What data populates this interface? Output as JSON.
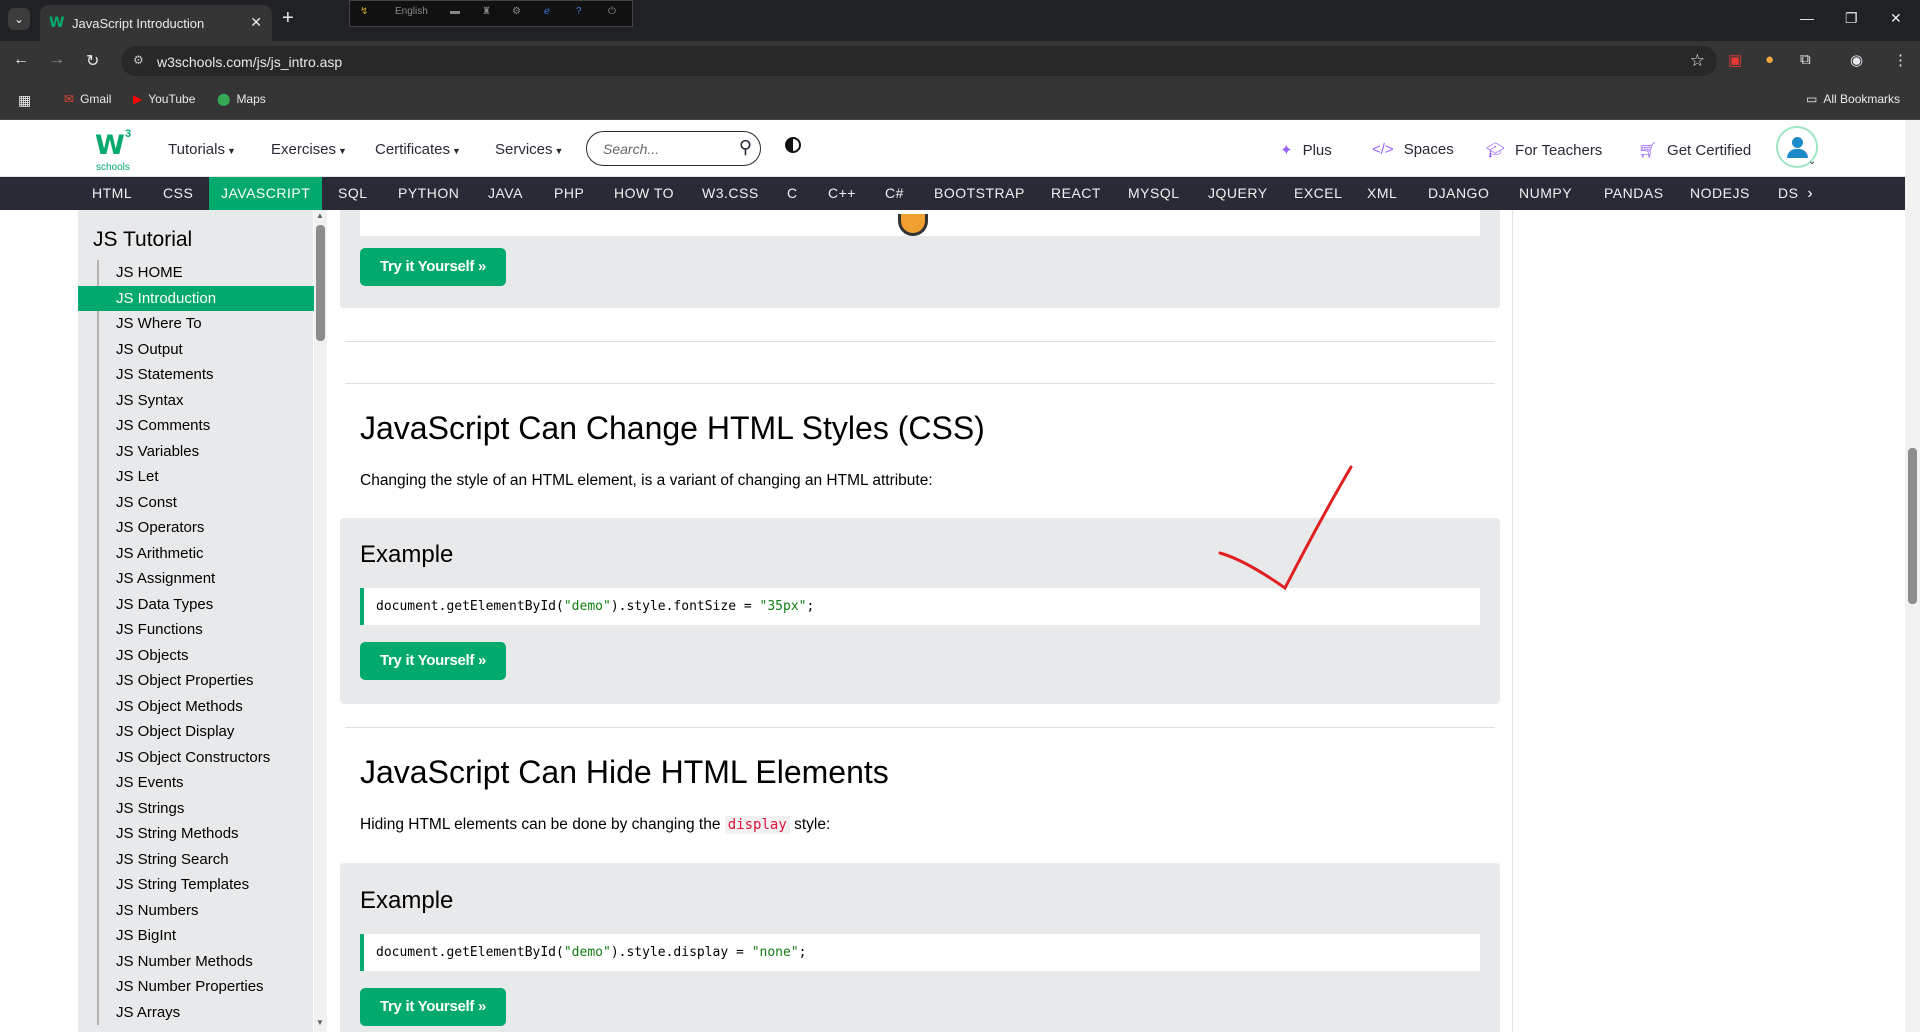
{
  "browser": {
    "tab_title": "JavaScript Introduction",
    "url": "w3schools.com/js/js_intro.asp",
    "toolbar_language": "English",
    "bookmarks": [
      {
        "label": "Gmail",
        "icon": "gmail-icon"
      },
      {
        "label": "YouTube",
        "icon": "youtube-icon"
      },
      {
        "label": "Maps",
        "icon": "maps-icon"
      }
    ],
    "all_bookmarks": "All Bookmarks"
  },
  "header": {
    "logo_main": "W",
    "logo_sup": "3",
    "logo_sub": "schools",
    "menus": [
      "Tutorials",
      "Exercises",
      "Certificates",
      "Services"
    ],
    "search_placeholder": "Search...",
    "right_links": [
      "Plus",
      "Spaces",
      "For Teachers",
      "Get Certified"
    ]
  },
  "subnav": {
    "items": [
      "HTML",
      "CSS",
      "JAVASCRIPT",
      "SQL",
      "PYTHON",
      "JAVA",
      "PHP",
      "HOW TO",
      "W3.CSS",
      "C",
      "C++",
      "C#",
      "BOOTSTRAP",
      "REACT",
      "MYSQL",
      "JQUERY",
      "EXCEL",
      "XML",
      "DJANGO",
      "NUMPY",
      "PANDAS",
      "NODEJS",
      "DS"
    ],
    "active": "JAVASCRIPT"
  },
  "sidebar": {
    "title": "JS Tutorial",
    "items": [
      "JS HOME",
      "JS Introduction",
      "JS Where To",
      "JS Output",
      "JS Statements",
      "JS Syntax",
      "JS Comments",
      "JS Variables",
      "JS Let",
      "JS Const",
      "JS Operators",
      "JS Arithmetic",
      "JS Assignment",
      "JS Data Types",
      "JS Functions",
      "JS Objects",
      "JS Object Properties",
      "JS Object Methods",
      "JS Object Display",
      "JS Object Constructors",
      "JS Events",
      "JS Strings",
      "JS String Methods",
      "JS String Search",
      "JS String Templates",
      "JS Numbers",
      "JS BigInt",
      "JS Number Methods",
      "JS Number Properties",
      "JS Arrays"
    ],
    "active": "JS Introduction"
  },
  "main": {
    "try_label": "Try it Yourself »",
    "section_css": {
      "heading": "JavaScript Can Change HTML Styles (CSS)",
      "text": "Changing the style of an HTML element, is a variant of changing an HTML attribute:",
      "example_title": "Example",
      "code_pre": "document.getElementById(",
      "code_str1": "\"demo\"",
      "code_mid": ").style.fontSize = ",
      "code_str2": "\"35px\"",
      "code_end": ";"
    },
    "section_hide": {
      "heading": "JavaScript Can Hide HTML Elements",
      "text_pre": "Hiding HTML elements can be done by changing the ",
      "text_code": "display",
      "text_post": " style:",
      "example_title": "Example",
      "code_pre": "document.getElementById(",
      "code_str1": "\"demo\"",
      "code_mid": ").style.display = ",
      "code_str2": "\"none\"",
      "code_end": ";"
    }
  },
  "colors": {
    "accent": "#04aa6d",
    "nav_dark": "#282a35",
    "annotation": "#e02020"
  }
}
